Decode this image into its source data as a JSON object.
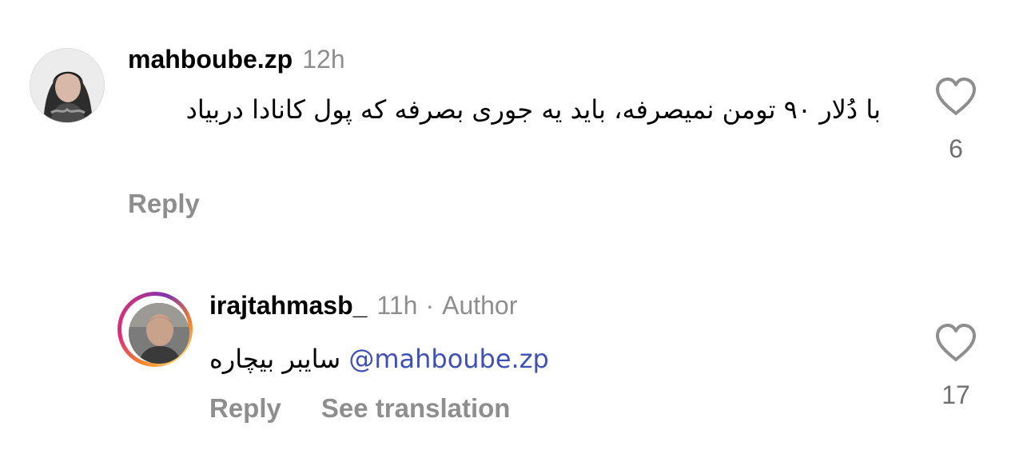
{
  "comments": [
    {
      "username": "mahboube.zp",
      "time": "12h",
      "text": "با دُلار ۹۰ تومن نمیصرفه، باید یه جوری بصرفه که پول کانادا دربیاد",
      "actions": {
        "reply": "Reply"
      },
      "likes": "6"
    },
    {
      "username": "irajtahmasb_",
      "time": "11h",
      "separator": "·",
      "badge": "Author",
      "mention": "@mahboube.zp",
      "text": "سایبر بیچاره",
      "actions": {
        "reply": "Reply",
        "translate": "See translation"
      },
      "likes": "17"
    }
  ],
  "icons": {
    "like": "heart-outline-icon",
    "avatar_ring_colors": [
      "#f58529",
      "#dd2a7b",
      "#8134af",
      "#feda77"
    ]
  }
}
